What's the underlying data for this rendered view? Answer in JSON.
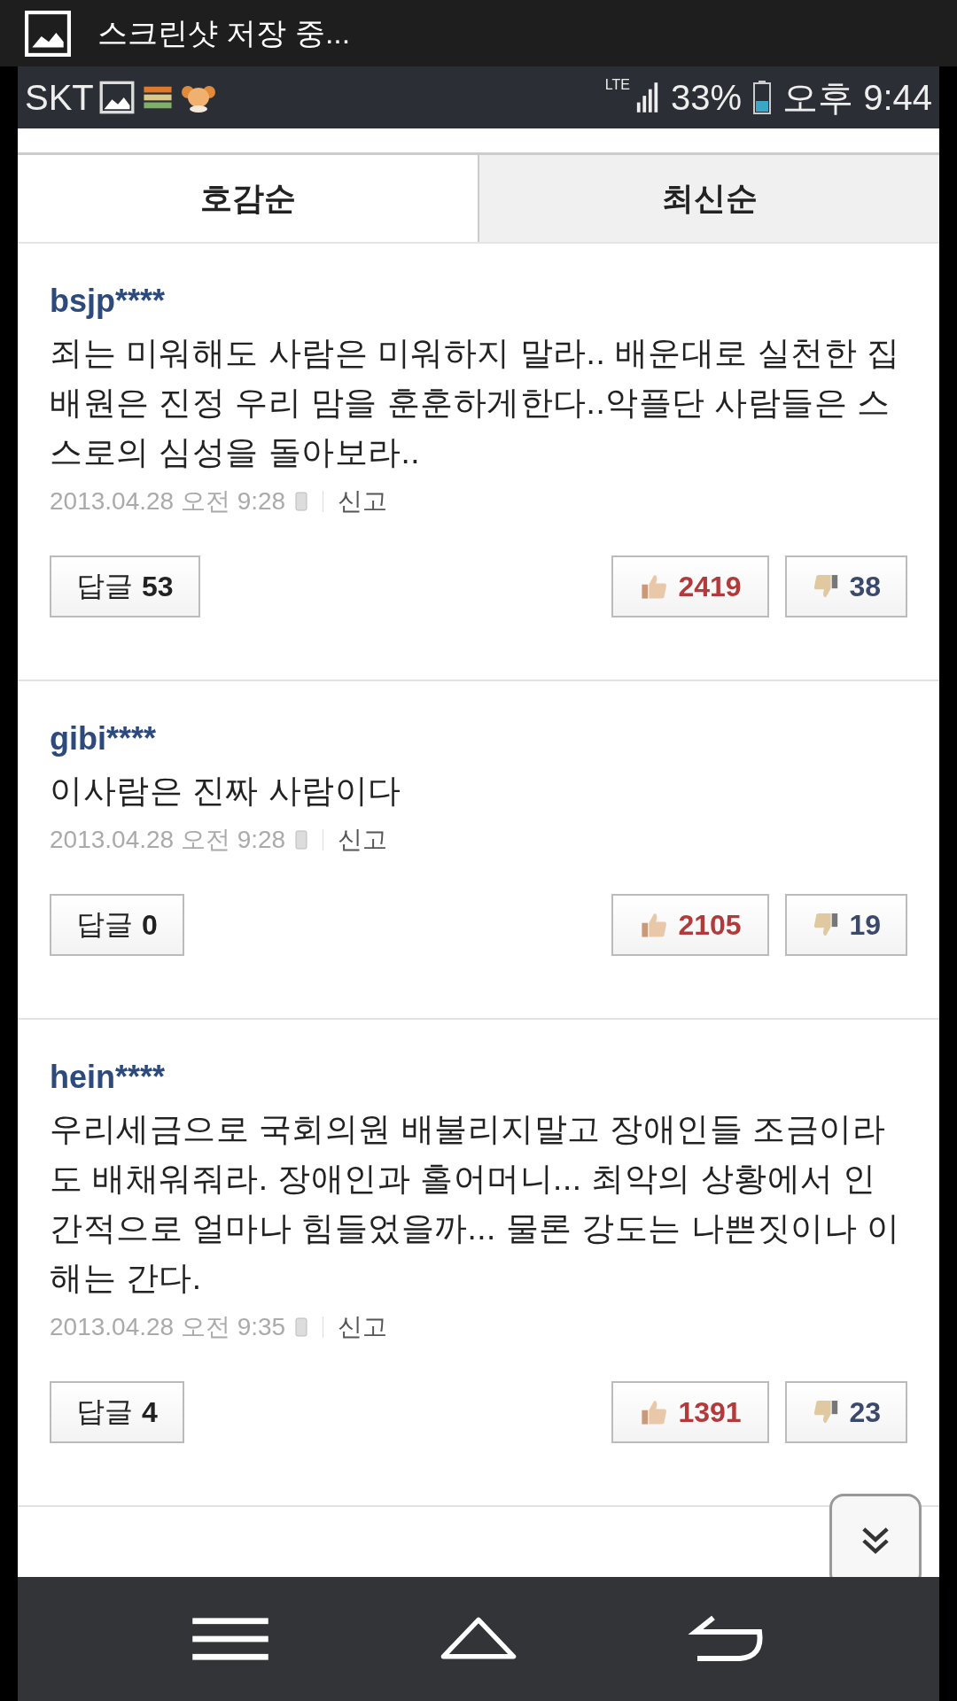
{
  "notification": {
    "text": "스크린샷 저장 중..."
  },
  "status_bar": {
    "carrier": "SKT",
    "network": "LTE",
    "battery": "33%",
    "time": "오후 9:44"
  },
  "tabs": [
    {
      "label": "호감순",
      "selected": true
    },
    {
      "label": "최신순",
      "selected": false
    }
  ],
  "comments": [
    {
      "user": "bsjp****",
      "text": "죄는 미워해도 사람은 미워하지 말라.. 배운대로 실천한 집배원은 진정 우리 맘을 훈훈하게한다..악플단 사람들은 스스로의 심성을 돌아보라..",
      "date": "2013.04.28 오전 9:28",
      "report": "신고",
      "reply_label": "답글",
      "replies": "53",
      "likes": "2419",
      "dislikes": "38"
    },
    {
      "user": "gibi****",
      "text": "이사람은 진짜 사람이다",
      "date": "2013.04.28 오전 9:28",
      "report": "신고",
      "reply_label": "답글",
      "replies": "0",
      "likes": "2105",
      "dislikes": "19"
    },
    {
      "user": "hein****",
      "text": "우리세금으로 국회의원 배불리지말고 장애인들 조금이라도 배채워줘라. 장애인과 홀어머니... 최악의 상황에서 인간적으로 얼마나 힘들었을까... 물론 강도는 나쁜짓이나 이해는 간다.",
      "date": "2013.04.28 오전 9:35",
      "report": "신고",
      "reply_label": "답글",
      "replies": "4",
      "likes": "1391",
      "dislikes": "23"
    }
  ]
}
